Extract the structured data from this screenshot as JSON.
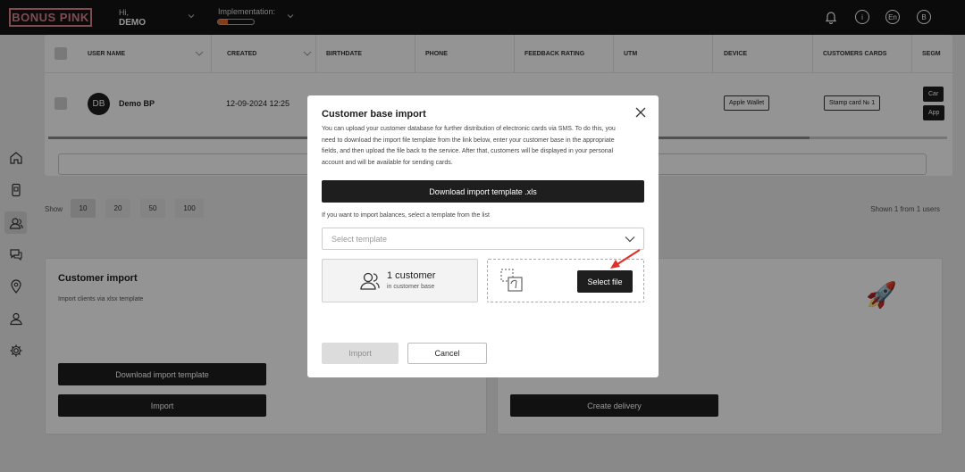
{
  "header": {
    "logo": "BONUS PINK",
    "greeting": "Hi,",
    "user": "DEMO",
    "implementation_label": "Implementation:",
    "implementation_progress": 0.28,
    "language": "En",
    "account_initial": "B",
    "info_symbol": "i"
  },
  "sidebar": {
    "items": [
      "home-icon",
      "mobile-card-icon",
      "customers-icon",
      "chat-icon",
      "location-icon",
      "profile-icon",
      "settings-icon"
    ],
    "active": "customers-icon"
  },
  "table": {
    "columns": [
      "USER NAME",
      "CREATED",
      "BIRTHDATE",
      "PHONE",
      "FEEDBACK RATING",
      "UTM",
      "DEVICE",
      "CUSTOMERS CARDS",
      "SEGM"
    ],
    "row": {
      "initials": "DB",
      "name": "Demo BP",
      "created": "12-09-2024 12:25",
      "device": "Apple Wallet",
      "card": "Stamp card № 1",
      "action1": "Car",
      "action2": "App"
    }
  },
  "pagination": {
    "show_label": "Show",
    "sizes": [
      "10",
      "20",
      "50",
      "100"
    ],
    "selected": "10",
    "shown_text": "Shown 1 from 1 users"
  },
  "import_panel": {
    "title": "Customer import",
    "subtitle": "Import clients via xlsx template",
    "download_label": "Download import template",
    "import_label": "Import"
  },
  "delivery_panel": {
    "create_label": "Create delivery",
    "rocket": "🚀"
  },
  "modal": {
    "title": "Customer base import",
    "description": "You can upload your customer database for further distribution of electronic cards via SMS. To do this, you need to download the import file template from the link below, enter your customer base in the appropriate fields, and then upload the file back to the service. After that, customers will be displayed in your personal account and will be available for sending cards.",
    "download_label": "Download import template .xls",
    "balances_hint": "If you want to import balances, select a template from the list",
    "select_placeholder": "Select template",
    "customer_count": "1 customer",
    "customer_sub": "in customer base",
    "select_file_label": "Select file",
    "import_label": "Import",
    "cancel_label": "Cancel"
  },
  "colors": {
    "brand_pink": "#e0828e",
    "dark": "#1e1e1e",
    "progress": "#e26a2c",
    "annotation_arrow": "#e0302b"
  }
}
